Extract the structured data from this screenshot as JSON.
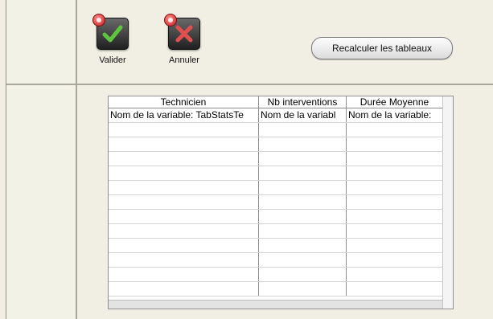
{
  "toolbar": {
    "validate_label": "Valider",
    "cancel_label": "Annuler",
    "recalc_label": "Recalculer les tableaux"
  },
  "table": {
    "columns": [
      "Technicien",
      "Nb interventions",
      "Durée Moyenne"
    ],
    "rows": [
      [
        "Nom de la variable: TabStatsTe",
        "Nom de la variabl",
        "Nom de la variable:"
      ]
    ]
  },
  "colors": {
    "background": "#f1efe3",
    "validate_check": "#5fc43f",
    "cancel_cross": "#e0504f",
    "badge": "#c61f1f"
  },
  "icons": {
    "validate": "checkmark-icon",
    "cancel": "cross-icon",
    "badge": "red-badge-icon"
  }
}
